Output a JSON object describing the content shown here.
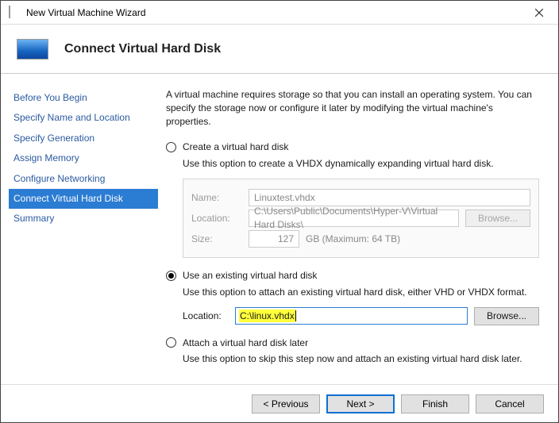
{
  "titlebar": {
    "title": "New Virtual Machine Wizard"
  },
  "header": {
    "title": "Connect Virtual Hard Disk"
  },
  "sidebar": {
    "items": [
      {
        "label": "Before You Begin"
      },
      {
        "label": "Specify Name and Location"
      },
      {
        "label": "Specify Generation"
      },
      {
        "label": "Assign Memory"
      },
      {
        "label": "Configure Networking"
      },
      {
        "label": "Connect Virtual Hard Disk"
      },
      {
        "label": "Summary"
      }
    ],
    "selected_index": 5
  },
  "content": {
    "intro": "A virtual machine requires storage so that you can install an operating system. You can specify the storage now or configure it later by modifying the virtual machine's properties.",
    "option_create": {
      "label": "Create a virtual hard disk",
      "desc": "Use this option to create a VHDX dynamically expanding virtual hard disk.",
      "name_label": "Name:",
      "name_value": "Linuxtest.vhdx",
      "loc_label": "Location:",
      "loc_value": "C:\\Users\\Public\\Documents\\Hyper-V\\Virtual Hard Disks\\",
      "browse": "Browse...",
      "size_label": "Size:",
      "size_value": "127",
      "size_units": "GB (Maximum: 64 TB)"
    },
    "option_existing": {
      "label": "Use an existing virtual hard disk",
      "desc": "Use this option to attach an existing virtual hard disk, either VHD or VHDX format.",
      "loc_label": "Location:",
      "loc_value": "C:\\linux.vhdx",
      "browse": "Browse..."
    },
    "option_later": {
      "label": "Attach a virtual hard disk later",
      "desc": "Use this option to skip this step now and attach an existing virtual hard disk later."
    }
  },
  "footer": {
    "previous": "< Previous",
    "next": "Next >",
    "finish": "Finish",
    "cancel": "Cancel"
  }
}
